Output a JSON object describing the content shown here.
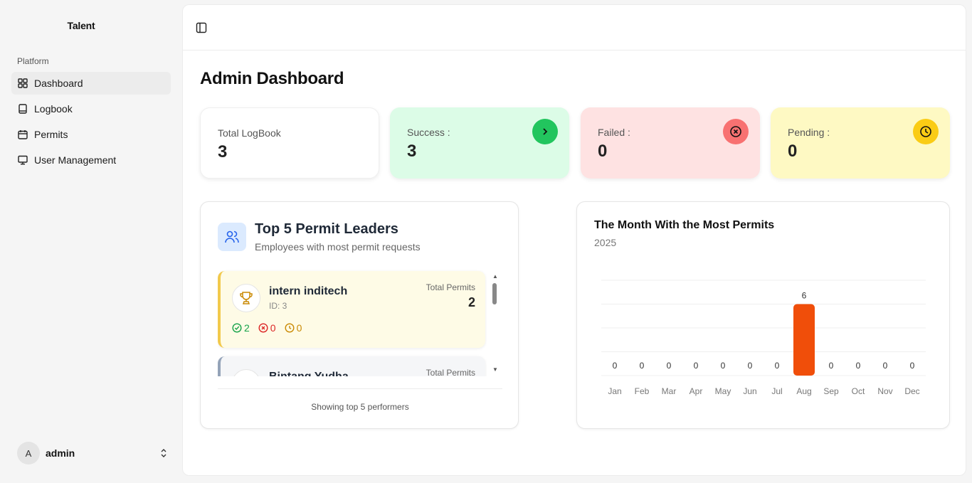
{
  "sidebar": {
    "brand": "Talent",
    "group_label": "Platform",
    "items": [
      {
        "label": "Dashboard",
        "icon": "dashboard-grid-icon",
        "active": true
      },
      {
        "label": "Logbook",
        "icon": "book-icon",
        "active": false
      },
      {
        "label": "Permits",
        "icon": "calendar-icon",
        "active": false
      },
      {
        "label": "User Management",
        "icon": "monitor-icon",
        "active": false
      }
    ],
    "user": {
      "initial": "A",
      "name": "admin"
    }
  },
  "header": {
    "title": "Admin Dashboard"
  },
  "stats": [
    {
      "label": "Total LogBook",
      "value": "3",
      "color": "#ffffff"
    },
    {
      "label": "Success :",
      "value": "3",
      "color": "#dcfce7",
      "icon": "chevron-right-icon"
    },
    {
      "label": "Failed :",
      "value": "0",
      "color": "#fee2e2",
      "icon": "x-circle-icon"
    },
    {
      "label": "Pending :",
      "value": "0",
      "color": "#fef9c3",
      "icon": "clock-icon"
    }
  ],
  "leaders": {
    "title": "Top 5 Permit Leaders",
    "subtitle": "Employees with most permit requests",
    "total_label": "Total Permits",
    "entries": [
      {
        "name": "intern inditech",
        "id": "ID: 3",
        "total": "2",
        "success": "2",
        "failed": "0",
        "pending": "0"
      },
      {
        "name": "Bintang Yudha",
        "id": "",
        "total": "",
        "success": "",
        "failed": "",
        "pending": ""
      }
    ],
    "footer": "Showing top 5 performers"
  },
  "chart_data": {
    "type": "bar",
    "title": "The Month With the Most Permits",
    "subtitle": "2025",
    "categories": [
      "Jan",
      "Feb",
      "Mar",
      "Apr",
      "May",
      "Jun",
      "Jul",
      "Aug",
      "Sep",
      "Oct",
      "Nov",
      "Dec"
    ],
    "values": [
      0,
      0,
      0,
      0,
      0,
      0,
      0,
      6,
      0,
      0,
      0,
      0
    ],
    "ylim": [
      0,
      8
    ],
    "grid": true,
    "bar_color": "#f04e0a"
  }
}
